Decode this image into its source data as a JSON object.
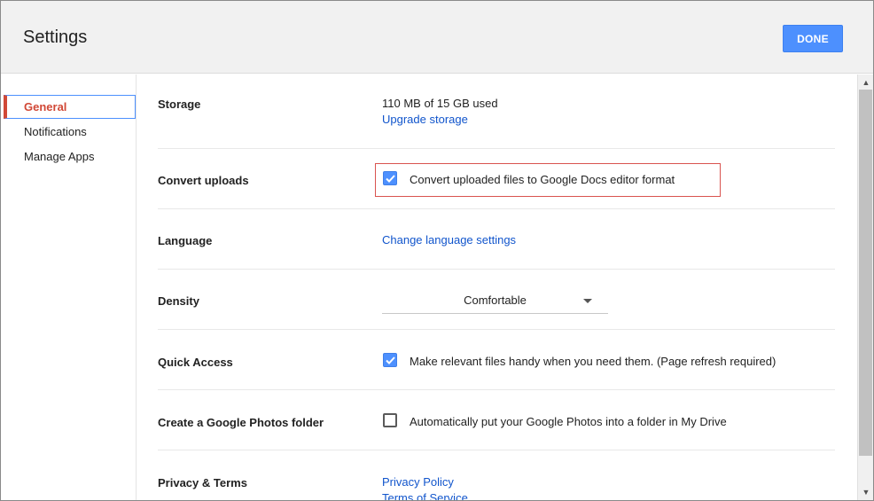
{
  "header": {
    "title": "Settings",
    "done_label": "DONE"
  },
  "sidebar": {
    "items": [
      {
        "label": "General",
        "active": true
      },
      {
        "label": "Notifications",
        "active": false
      },
      {
        "label": "Manage Apps",
        "active": false
      }
    ]
  },
  "settings": {
    "storage": {
      "label": "Storage",
      "usage": "110 MB of 15 GB used",
      "link": "Upgrade storage"
    },
    "convert": {
      "label": "Convert uploads",
      "checkbox_label": "Convert uploaded files to Google Docs editor format",
      "checked": true
    },
    "language": {
      "label": "Language",
      "link": "Change language settings"
    },
    "density": {
      "label": "Density",
      "selected": "Comfortable"
    },
    "quick_access": {
      "label": "Quick Access",
      "checkbox_label": "Make relevant files handy when you need them. (Page refresh required)",
      "checked": true
    },
    "photos": {
      "label": "Create a Google Photos folder",
      "checkbox_label": "Automatically put your Google Photos into a folder in My Drive",
      "checked": false
    },
    "privacy": {
      "label": "Privacy & Terms",
      "link1": "Privacy Policy",
      "link2": "Terms of Service"
    }
  },
  "colors": {
    "accent": "#4d90fe",
    "active_nav": "#d14836",
    "link": "#1155cc",
    "highlight": "#d9534f"
  },
  "icons": {
    "check": "check-icon",
    "caret": "chevron-down-icon",
    "scroll_up": "arrow-up-icon",
    "scroll_down": "arrow-down-icon"
  }
}
